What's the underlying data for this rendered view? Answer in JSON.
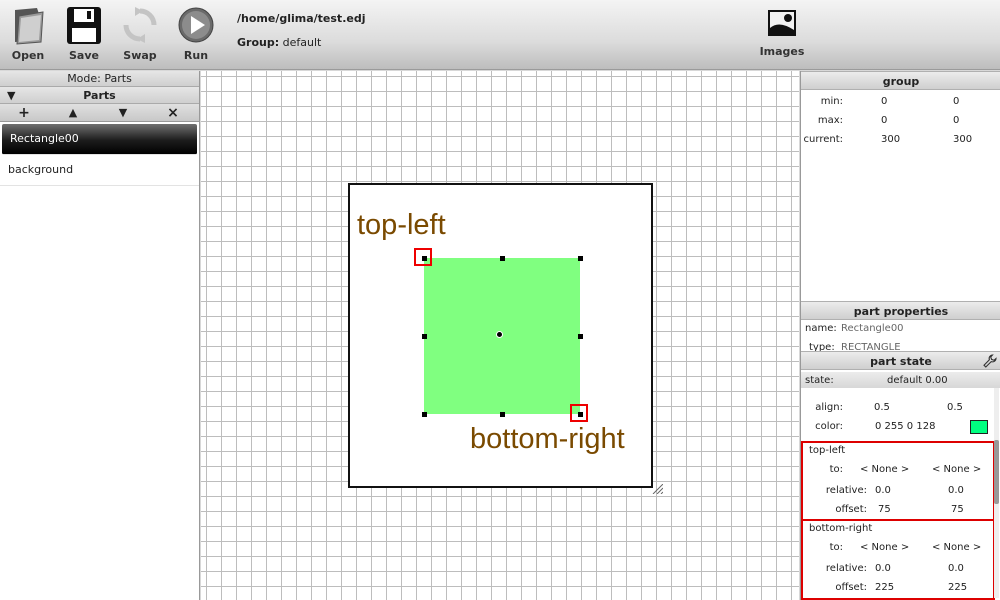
{
  "toolbar": {
    "open_label": "Open",
    "save_label": "Save",
    "swap_label": "Swap",
    "run_label": "Run",
    "file_path": "/home/glima/test.edj",
    "group_prefix": "Group:",
    "group_name": "default",
    "images_label": "Images"
  },
  "left_panel": {
    "mode_label": "Mode: Parts",
    "parts_header": "Parts",
    "tools": {
      "add": "+",
      "up": "▲",
      "down": "▼",
      "remove": "×"
    },
    "parts": [
      "Rectangle00",
      "background"
    ]
  },
  "canvas": {
    "top_left_label": "top-left",
    "bottom_right_label": "bottom-right",
    "rect_color": "#80ff80"
  },
  "right_panel": {
    "group": {
      "title": "group",
      "min_label": "min:",
      "min_w": "0",
      "min_h": "0",
      "max_label": "max:",
      "max_w": "0",
      "max_h": "0",
      "current_label": "current:",
      "current_w": "300",
      "current_h": "300"
    },
    "part_properties": {
      "title": "part properties",
      "name_label": "name:",
      "name_value": "Rectangle00",
      "type_label": "type:",
      "type_value": "RECTANGLE"
    },
    "part_state": {
      "title": "part state",
      "state_label": "state:",
      "state_value": "default 0.00",
      "visible_value": "true",
      "align_label": "align:",
      "align_x": "0.5",
      "align_y": "0.5",
      "color_label": "color:",
      "color_value": "0 255 0 128",
      "swatch_color": "#00ff80"
    },
    "top_left": {
      "title": "top-left",
      "to_label": "to:",
      "to_x": "< None >",
      "to_y": "< None >",
      "relative_label": "relative:",
      "relative_x": "0.0",
      "relative_y": "0.0",
      "offset_label": "offset:",
      "offset_x": "75",
      "offset_y": "75"
    },
    "bottom_right": {
      "title": "bottom-right",
      "to_label": "to:",
      "to_x": "< None >",
      "to_y": "< None >",
      "relative_label": "relative:",
      "relative_x": "0.0",
      "relative_y": "0.0",
      "offset_label": "offset:",
      "offset_x": "225",
      "offset_y": "225"
    }
  }
}
